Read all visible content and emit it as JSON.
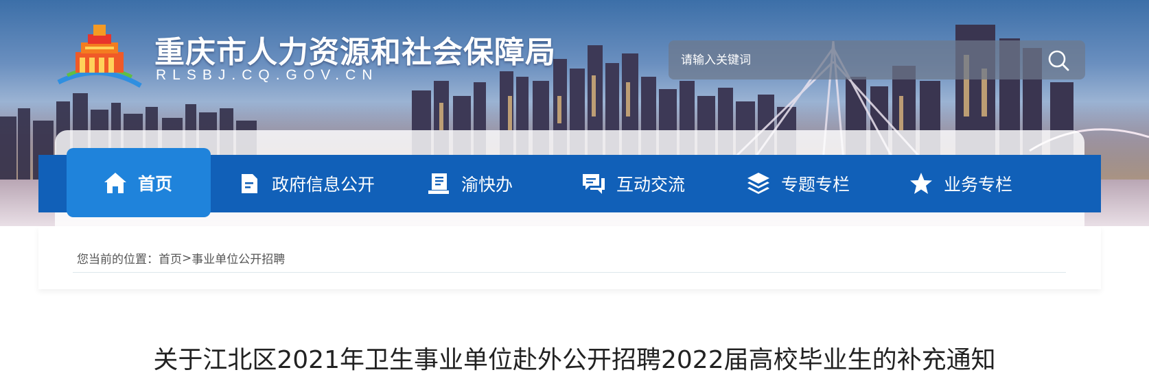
{
  "header": {
    "title": "重庆市人力资源和社会保障局",
    "domain": "RLSBJ.CQ.GOV.CN"
  },
  "search": {
    "placeholder": "请输入关键词",
    "icon": "search-icon"
  },
  "nav": {
    "items": [
      {
        "label": "首页",
        "icon": "home-icon",
        "active": true
      },
      {
        "label": "政府信息公开",
        "icon": "document-icon",
        "active": false
      },
      {
        "label": "渝快办",
        "icon": "service-icon",
        "active": false
      },
      {
        "label": "互动交流",
        "icon": "chat-icon",
        "active": false
      },
      {
        "label": "专题专栏",
        "icon": "layers-icon",
        "active": false
      },
      {
        "label": "业务专栏",
        "icon": "star-icon",
        "active": false
      }
    ]
  },
  "breadcrumb": {
    "prefix": "您当前的位置：",
    "home": "首页",
    "separator": ">",
    "current": "事业单位公开招聘"
  },
  "article": {
    "title": "关于江北区2021年卫生事业单位赴外公开招聘2022届高校毕业生的补充通知"
  },
  "colors": {
    "nav_blue": "#1160b8",
    "nav_active": "#1f83db"
  }
}
